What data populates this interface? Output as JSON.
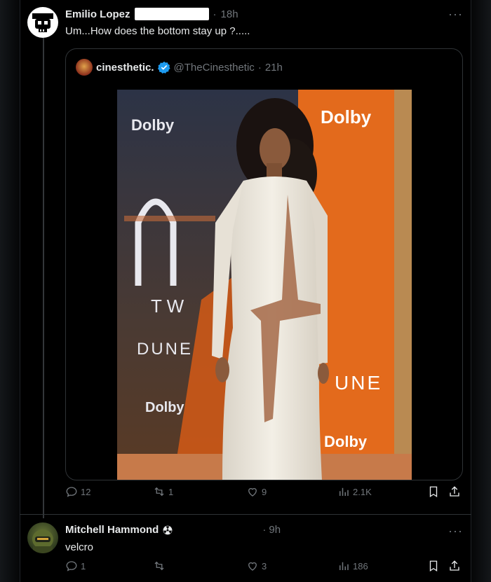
{
  "tweet": {
    "author_name": "Emilio Lopez",
    "time": "18h",
    "time_sep": "·",
    "text": "Um...How does the bottom stay up ?.....",
    "more": "···",
    "quote": {
      "author_name": "cinesthetic.",
      "handle": "@TheCinesthetic",
      "time_sep": "·",
      "time": "21h",
      "photo_texts": {
        "dolby_top_left": "Dolby",
        "dolby_top_right": "Dolby",
        "dolby_mid_left": "Dolby",
        "dolby_bottom_right": "Dolby",
        "dune_left": "DUNE",
        "dune_right": "UNE",
        "tw": "T W"
      }
    },
    "stats": {
      "replies": "12",
      "reposts": "1",
      "likes": "9",
      "views": "2.1K"
    }
  },
  "reply": {
    "author_name": "Mitchell Hammond",
    "time": "9h",
    "time_sep": "·",
    "text": "velcro",
    "more": "···",
    "stats": {
      "replies": "1",
      "reposts": "",
      "likes": "3",
      "views": "186"
    }
  },
  "colors": {
    "background": "#000000",
    "text": "#e7e9ea",
    "muted": "#71767b",
    "verified": "#1d9bf0",
    "border": "#2f3336",
    "orange": "#e36a1c"
  }
}
